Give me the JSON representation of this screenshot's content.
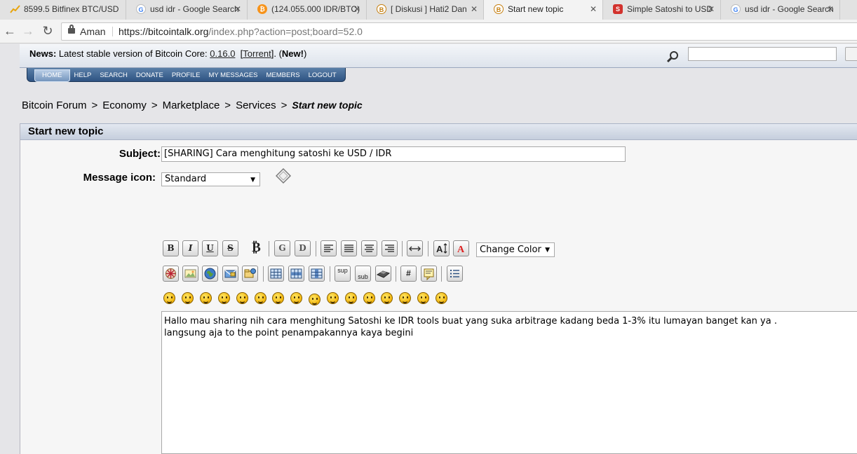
{
  "browser": {
    "tabs": [
      {
        "label": "8599.5 Bitfinex BTC/USD",
        "icon": "chart-favicon-icon"
      },
      {
        "label": "usd idr - Google Search",
        "icon": "google-favicon-icon"
      },
      {
        "label": "(124.055.000 IDR/BTC)",
        "icon": "bitcoin-favicon-icon"
      },
      {
        "label": "[ Diskusi ] Hati2 Dan",
        "icon": "forum-favicon-icon"
      },
      {
        "label": "Start new topic",
        "icon": "forum-favicon-icon",
        "active": true
      },
      {
        "label": "Simple Satoshi to USD",
        "icon": "satoshi-favicon-icon"
      },
      {
        "label": "usd idr - Google Search",
        "icon": "google-favicon-icon"
      }
    ],
    "close_glyph": "✕",
    "secure_label": "Aman",
    "url_host": "https://bitcointalk.org",
    "url_path": "/index.php?action=post;board=52.0"
  },
  "news": {
    "label": "News:",
    "text": "Latest stable version of Bitcoin Core:",
    "version": "0.16.0",
    "torrent": "Torrent",
    "new_label": "New!"
  },
  "search": {
    "placeholder": ""
  },
  "menu": [
    "HOME",
    "HELP",
    "SEARCH",
    "DONATE",
    "PROFILE",
    "MY MESSAGES",
    "MEMBERS",
    "LOGOUT"
  ],
  "breadcrumb": {
    "items": [
      "Bitcoin Forum",
      "Economy",
      "Marketplace",
      "Services"
    ],
    "current": "Start new topic",
    "separator": ">"
  },
  "form": {
    "header": "Start new topic",
    "subject_label": "Subject:",
    "subject_value": "[SHARING] Cara menghitung satoshi ke USD / IDR",
    "icon_label": "Message icon:",
    "icon_value": "Standard",
    "change_color_label": "Change Color",
    "message_value": "Hallo mau sharing nih cara menghitung Satoshi ke IDR tools buat yang suka arbitrage kadang beda 1-3% itu lumayan banget kan ya .\nlangsung aja to the point penampakannya kaya begini"
  },
  "bbcode_buttons": {
    "bold": "B",
    "italic": "I",
    "underline": "U",
    "strike": "S",
    "bitcoin": "₿",
    "glow": "G",
    "shadow": "D",
    "sup": "sup",
    "sub": "sub",
    "code": "#"
  },
  "smileys": [
    "smiley",
    "wink",
    "cheesy",
    "grin",
    "angry",
    "sad",
    "shocked",
    "cool",
    "huh",
    "rolleyes",
    "tongue",
    "embarrassed",
    "lipsrsealed",
    "undecided",
    "kiss",
    "cry"
  ]
}
